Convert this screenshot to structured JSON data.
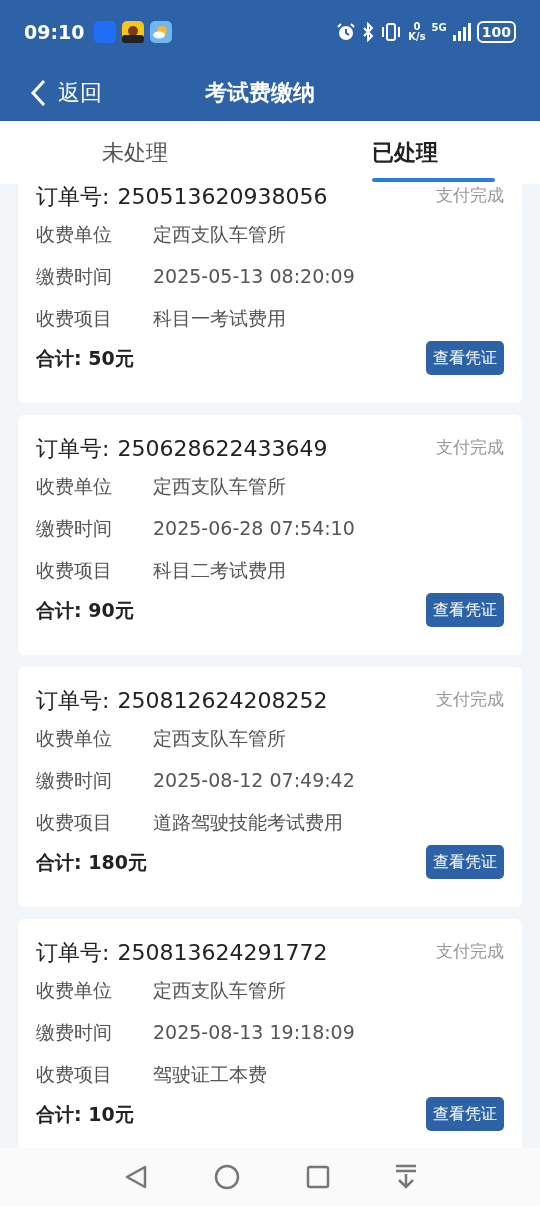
{
  "status_bar": {
    "time": "09:10",
    "net_speed_value": "0",
    "net_speed_unit": "K/s",
    "network": "5G",
    "battery": "100"
  },
  "header": {
    "back": "返回",
    "title": "考试费缴纳"
  },
  "tabs": [
    {
      "label": "未处理",
      "selected": false
    },
    {
      "label": "已处理",
      "selected": true
    }
  ],
  "orders": [
    {
      "order_label": "订单号:",
      "order_no": "250513620938056",
      "status": "支付完成",
      "fields": [
        {
          "label": "收费单位",
          "value": "定西支队车管所"
        },
        {
          "label": "缴费时间",
          "value": "2025-05-13 08:20:09"
        },
        {
          "label": "收费项目",
          "value": "科目一考试费用"
        }
      ],
      "total": "合计: 50元",
      "button": "查看凭证"
    },
    {
      "order_label": "订单号:",
      "order_no": "250628622433649",
      "status": "支付完成",
      "fields": [
        {
          "label": "收费单位",
          "value": "定西支队车管所"
        },
        {
          "label": "缴费时间",
          "value": "2025-06-28 07:54:10"
        },
        {
          "label": "收费项目",
          "value": "科目二考试费用"
        }
      ],
      "total": "合计: 90元",
      "button": "查看凭证"
    },
    {
      "order_label": "订单号:",
      "order_no": "250812624208252",
      "status": "支付完成",
      "fields": [
        {
          "label": "收费单位",
          "value": "定西支队车管所"
        },
        {
          "label": "缴费时间",
          "value": "2025-08-12 07:49:42"
        },
        {
          "label": "收费项目",
          "value": "道路驾驶技能考试费用"
        }
      ],
      "total": "合计: 180元",
      "button": "查看凭证"
    },
    {
      "order_label": "订单号:",
      "order_no": "250813624291772",
      "status": "支付完成",
      "fields": [
        {
          "label": "收费单位",
          "value": "定西支队车管所"
        },
        {
          "label": "缴费时间",
          "value": "2025-08-13 19:18:09"
        },
        {
          "label": "收费项目",
          "value": "驾驶证工本费"
        }
      ],
      "total": "合计: 10元",
      "button": "查看凭证"
    }
  ]
}
